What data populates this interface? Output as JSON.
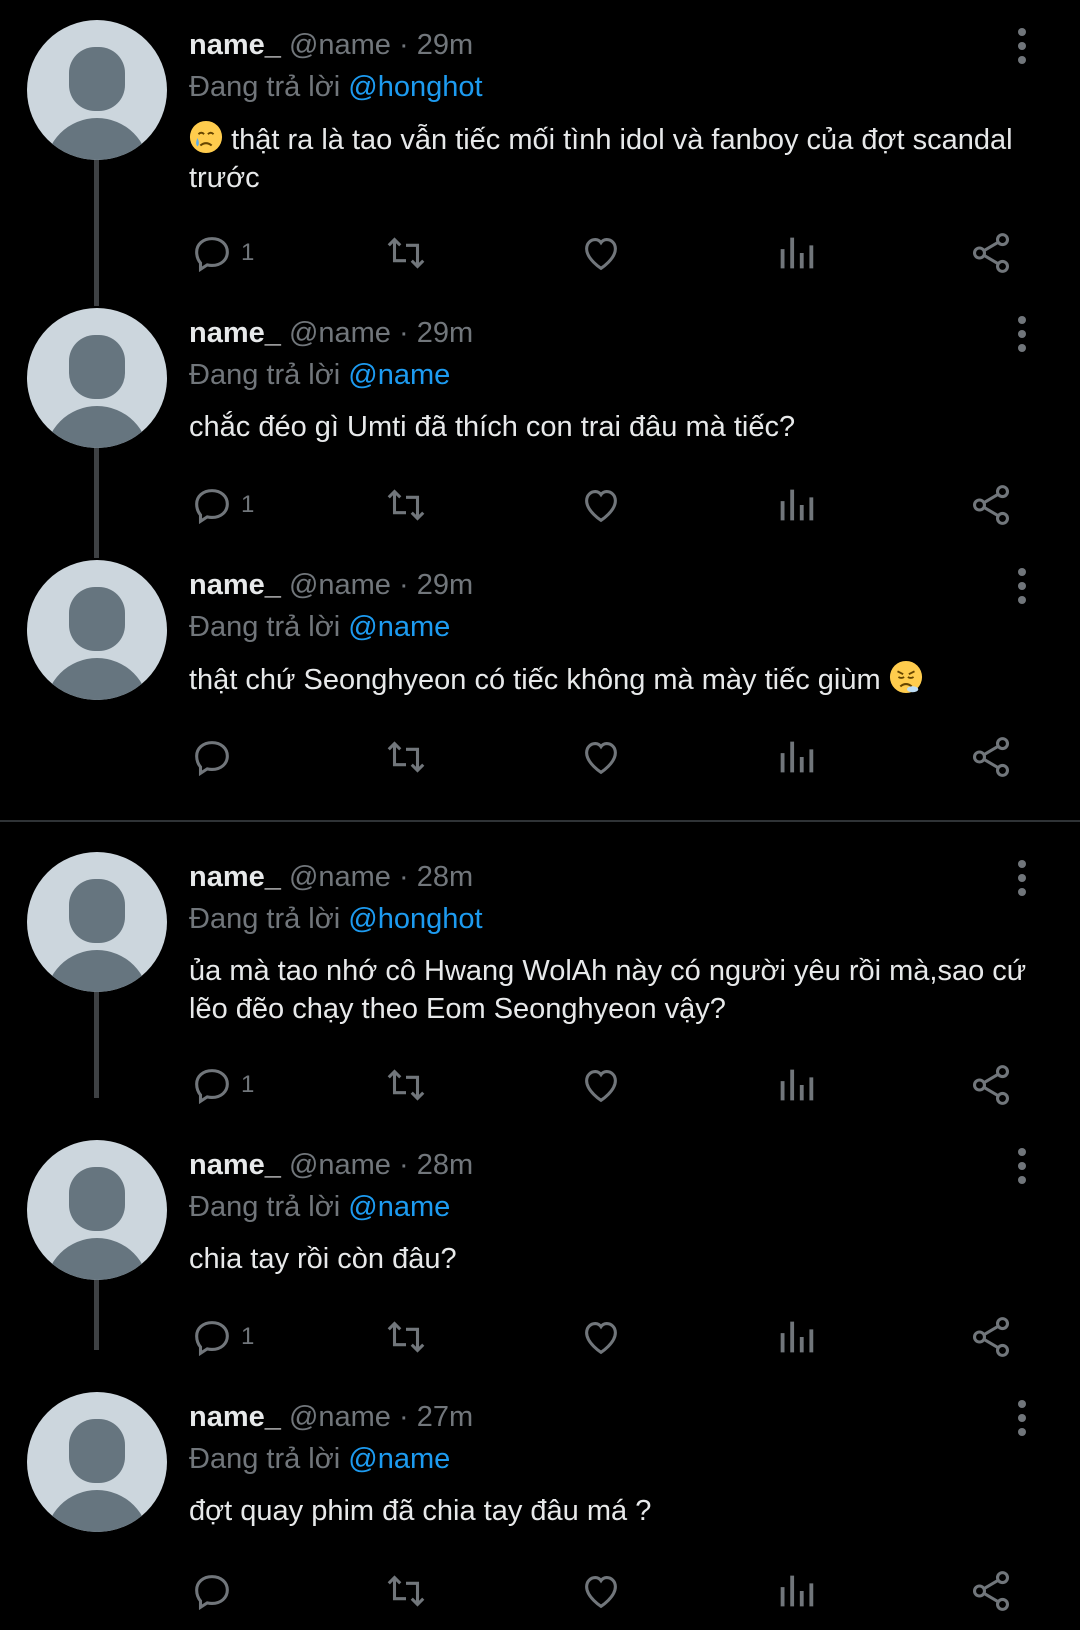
{
  "colors": {
    "background": "#000000",
    "text": "#e7e9ea",
    "muted": "#71767b",
    "mention": "#1d9bf0",
    "avatar_bg": "#ccd6dd",
    "avatar_fg": "#66757f"
  },
  "reply_prefix": "Đang trả lời",
  "posts": [
    {
      "name": "name_",
      "handle": "@name",
      "separator": "·",
      "time": "29m",
      "reply_to": "@honghot",
      "text": "thật ra là tao vẫn tiếc mối tình idol và fanboy của đợt scandal trước",
      "leading_emoji": "crying-face",
      "reply_count": "1"
    },
    {
      "name": "name_",
      "handle": "@name",
      "separator": "·",
      "time": "29m",
      "reply_to": "@name",
      "text": "chắc đéo gì Umti đã thích con trai đâu mà tiếc?",
      "reply_count": "1"
    },
    {
      "name": "name_",
      "handle": "@name",
      "separator": "·",
      "time": "29m",
      "reply_to": "@name",
      "text": "thật chứ Seonghyeon có tiếc không mà mày tiếc giùm",
      "trailing_emoji": "disappointed-relieved-face",
      "reply_count": ""
    },
    {
      "name": "name_",
      "handle": "@name",
      "separator": "·",
      "time": "28m",
      "reply_to": "@honghot",
      "text": "ủa mà tao nhớ cô Hwang WolAh này có người yêu rồi mà,sao cứ lẽo đẽo chạy theo Eom Seonghyeon vậy?",
      "reply_count": "1"
    },
    {
      "name": "name_",
      "handle": "@name",
      "separator": "·",
      "time": "28m",
      "reply_to": "@name",
      "text": "chia tay rồi còn đâu?",
      "reply_count": "1"
    },
    {
      "name": "name_",
      "handle": "@name",
      "separator": "·",
      "time": "27m",
      "reply_to": "@name",
      "text": "đợt quay phim đã chia tay đâu má ?",
      "reply_count": ""
    }
  ],
  "icons": {
    "reply": "reply-icon",
    "retweet": "retweet-icon",
    "like": "like-icon",
    "views": "views-icon",
    "share": "share-icon",
    "more": "more-options-icon"
  }
}
